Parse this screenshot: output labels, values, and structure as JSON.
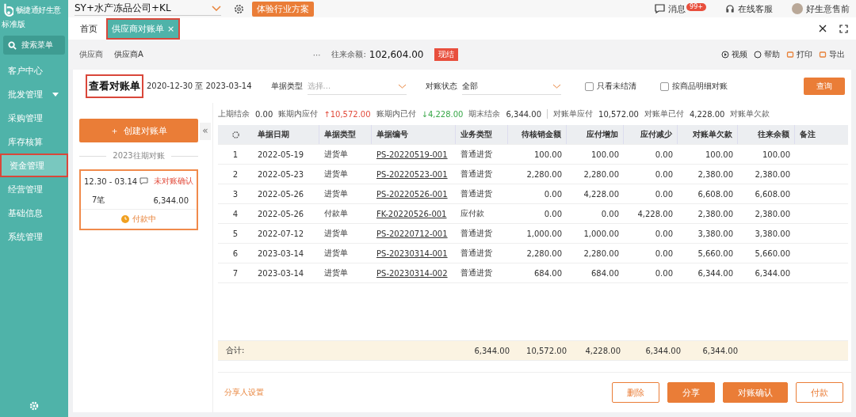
{
  "brand": {
    "name": "畅捷通好生意",
    "edition": "标准版"
  },
  "topbar": {
    "company": "SY+水产冻品公司+KL",
    "promo": "体验行业方案",
    "messages": "消息",
    "badge": "99+",
    "service": "在线客服",
    "user": "好生意售前"
  },
  "sidebar": {
    "search": "搜索菜单",
    "items": [
      {
        "label": "客户中心",
        "selected": false,
        "expandable": false,
        "highlighted": false
      },
      {
        "label": "批发管理",
        "selected": false,
        "expandable": true,
        "highlighted": false
      },
      {
        "label": "采购管理",
        "selected": false,
        "expandable": false,
        "highlighted": false
      },
      {
        "label": "库存核算",
        "selected": false,
        "expandable": false,
        "highlighted": false
      },
      {
        "label": "资金管理",
        "selected": true,
        "expandable": false,
        "highlighted": true
      },
      {
        "label": "经营管理",
        "selected": false,
        "expandable": false,
        "highlighted": false
      },
      {
        "label": "基础信息",
        "selected": false,
        "expandable": false,
        "highlighted": false
      },
      {
        "label": "系统管理",
        "selected": false,
        "expandable": false,
        "highlighted": false
      }
    ]
  },
  "tabs": [
    {
      "label": "首页",
      "selected": false,
      "closable": false,
      "highlighted": false
    },
    {
      "label": "供应商对账单",
      "selected": true,
      "closable": true,
      "close": "×",
      "highlighted": true
    }
  ],
  "supplier_bar": {
    "label": "供应商",
    "value": "供应商A",
    "more": "···",
    "balance_label": "往来余额:",
    "balance": "102,604.00",
    "badge": "现结",
    "actions": [
      "视频",
      "帮助",
      "打印",
      "导出"
    ]
  },
  "header": {
    "title": "查看对账单",
    "title_highlighted": true,
    "period": "2020-12-30 至 2023-03-14",
    "doc_type_label": "单据类型",
    "doc_type_placeholder": "选择...",
    "status_label": "对账状态",
    "status_value": "全部",
    "checks": [
      {
        "label": "只看未结清",
        "checked": false
      },
      {
        "label": "按商品明细对账",
        "checked": false
      }
    ],
    "query": "查询"
  },
  "left_panel": {
    "create_icon": "＋",
    "create": "创建对账单",
    "collapse": "«",
    "section": "2023往期对账",
    "card": {
      "range": "12.30 - 03.14",
      "status": "未对账确认",
      "count": "7笔",
      "amount": "6,344.00",
      "progress": "付款中",
      "selected": true
    }
  },
  "summary": [
    {
      "label": "上期结余",
      "value": "0.00",
      "kind": "plain"
    },
    {
      "label": "账期内应付",
      "arrow": "↑",
      "value": "10,572.00",
      "kind": "up"
    },
    {
      "label": "账期内已付",
      "arrow": "↓",
      "value": "4,228.00",
      "kind": "down"
    },
    {
      "label": "期末结余",
      "value": "6,344.00",
      "kind": "plain"
    },
    {
      "label": "对账单应付",
      "value": "10,572.00",
      "kind": "plain"
    },
    {
      "label": "对账单已付",
      "value": "4,228.00",
      "kind": "plain"
    },
    {
      "label": "对账单欠款",
      "kind": "plain"
    }
  ],
  "table": {
    "columns": [
      "",
      "单据日期",
      "单据类型",
      "单据编号",
      "业务类型",
      "待核销金额",
      "应付增加",
      "应付减少",
      "对账单欠款",
      "往来余额",
      "备注"
    ],
    "rows": [
      [
        "1",
        "2022-05-19",
        "进货单",
        "PS-20220519-001",
        "普通进货",
        "100.00",
        "100.00",
        "0.00",
        "100.00",
        "100.00"
      ],
      [
        "2",
        "2022-05-23",
        "进货单",
        "PS-20220523-001",
        "普通进货",
        "2,280.00",
        "2,280.00",
        "0.00",
        "2,380.00",
        "2,380.00"
      ],
      [
        "3",
        "2022-05-26",
        "进货单",
        "PS-20220526-001",
        "普通进货",
        "0.00",
        "4,228.00",
        "0.00",
        "6,608.00",
        "6,608.00"
      ],
      [
        "4",
        "2022-05-26",
        "付款单",
        "FK-20220526-001",
        "应付款",
        "0.00",
        "0.00",
        "4,228.00",
        "2,380.00",
        "2,380.00"
      ],
      [
        "5",
        "2022-07-12",
        "进货单",
        "PS-20220712-001",
        "普通进货",
        "1,000.00",
        "1,000.00",
        "0.00",
        "3,380.00",
        "3,380.00"
      ],
      [
        "6",
        "2023-03-14",
        "进货单",
        "PS-20230314-001",
        "普通进货",
        "2,280.00",
        "2,280.00",
        "0.00",
        "5,660.00",
        "5,660.00"
      ],
      [
        "7",
        "2023-03-14",
        "进货单",
        "PS-20230314-002",
        "普通进货",
        "684.00",
        "684.00",
        "0.00",
        "6,344.00",
        "6,344.00"
      ]
    ],
    "totals_label": "合计:",
    "totals": [
      "6,344.00",
      "10,572.00",
      "4,228.00",
      "6,344.00",
      "6,344.00"
    ]
  },
  "footer": {
    "share_settings": "分享人设置",
    "buttons": [
      {
        "label": "删除",
        "kind": "outline"
      },
      {
        "label": "分享",
        "kind": "solid"
      },
      {
        "label": "对账确认",
        "kind": "solid"
      },
      {
        "label": "付款",
        "kind": "outline"
      }
    ]
  }
}
